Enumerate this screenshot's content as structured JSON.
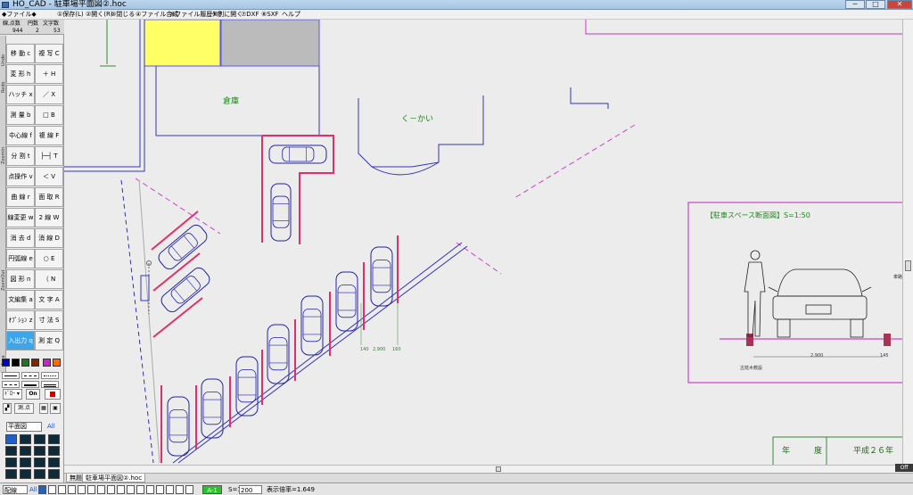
{
  "window": {
    "title": "HO_CAD - 駐車場平面図②.hoc",
    "buttons": {
      "minimize": "─",
      "maximize": "□",
      "close": "✕"
    }
  },
  "menu": [
    "◆ファイル◆",
    "①保存(L)",
    "②開く(R)",
    "③閉じる",
    "④ファイル合成",
    "⑤ファイル履歴ｸﾘｱ",
    "⑥別に開く",
    "⑦DXF",
    "⑧SXF",
    "ヘルプ"
  ],
  "counts": {
    "labels": [
      "線,点数",
      "円数",
      "文字数"
    ],
    "values": [
      "944",
      "2",
      "53"
    ]
  },
  "side_labels": [
    "Undo",
    "Redo",
    "ZoomIn",
    "ZoomOut",
    "Area"
  ],
  "tools": [
    [
      "移 動 c",
      "複 写 C"
    ],
    [
      "変 形 h",
      "＋ H"
    ],
    [
      "ハッチ x",
      "／ X"
    ],
    [
      "測 量 b",
      "□ B"
    ],
    [
      "中心線 f",
      "複 線 F"
    ],
    [
      "分 割 t",
      "├─┤ T"
    ],
    [
      "点操作 v",
      "＜ V"
    ],
    [
      "曲 線 r",
      "面 取 R"
    ],
    [
      "線変更 w",
      "2 線 W"
    ],
    [
      "消 去 d",
      "消 線 D"
    ],
    [
      "円弧線 e",
      "○ E"
    ],
    [
      "図 形 n",
      "（ N"
    ],
    [
      "文編集 a",
      "文 字 A"
    ],
    [
      "ｵﾌﾟｼｮﾝ z",
      "寸 法 S"
    ],
    [
      "入出力 q",
      "測 定 Q"
    ]
  ],
  "selected_tool": "入出力 q",
  "palette": [
    "#0000cc",
    "#000000",
    "#1a7a1a",
    "#7a2a00",
    "#d01ed0",
    "#ff6a00"
  ],
  "controls": {
    "line_type": "ﾄﾞﾛｰ",
    "on_label": "On",
    "measure_label": "測.点",
    "layer_group": "平面図",
    "layer_all": "All"
  },
  "drawing": {
    "warehouse": "倉庫",
    "kukai": "く－かい",
    "section_title": "【駐車スペース断面図】S=1:50",
    "dim_2900": "2,900",
    "dim_140": "140",
    "dim_160": "160",
    "dim_2900_plan": "2,900",
    "dim_2900_section": "2,900",
    "dim_145": "145",
    "label_wood": "古枕木敷設",
    "label_right": "車路",
    "titleblock_year": "年　　　度",
    "titleblock_era": "平成２６年"
  },
  "tabs": [
    "無題",
    "駐車場平面図②.hoc"
  ],
  "scrollbar": {
    "off_tag": "Off"
  },
  "status": {
    "layer": "配線",
    "all": "All",
    "mode": "A-1",
    "scale_label": "S=1",
    "scale_value": "200",
    "zoom": "表示倍率=1.649"
  }
}
